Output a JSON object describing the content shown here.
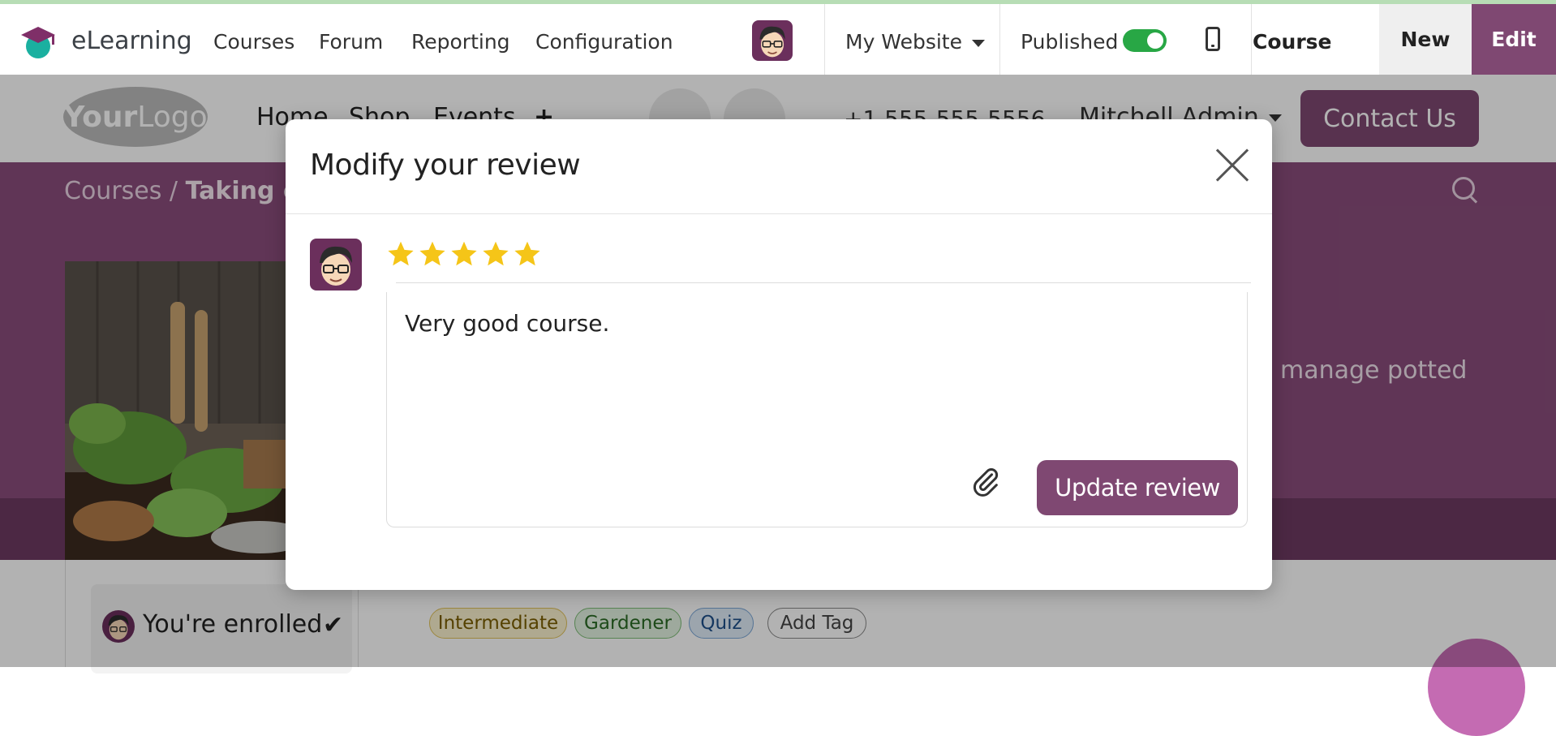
{
  "navbar": {
    "app_name": "eLearning",
    "menu": [
      "Courses",
      "Forum",
      "Reporting",
      "Configuration"
    ],
    "website_selector": "My Website",
    "published_label": "Published",
    "published": true,
    "course_label": "Course",
    "new_label": "New",
    "edit_label": "Edit"
  },
  "website": {
    "logo_bold": "Your",
    "logo_light": "Logo",
    "menu": [
      "Home",
      "Shop",
      "Events"
    ],
    "phone": "+1 555-555-5556",
    "user": "Mitchell Admin",
    "contact_label": "Contact Us",
    "breadcrumb_root": "Courses",
    "breadcrumb_sep": "/",
    "breadcrumb_current": "Taking c",
    "description_fragment": "manage potted",
    "enrolled_label": "You're enrolled",
    "tags": [
      "Intermediate",
      "Gardener",
      "Quiz",
      "Add Tag"
    ]
  },
  "modal": {
    "title": "Modify your review",
    "rating": 5,
    "rating_max": 5,
    "review_text": "Very good course.",
    "submit_label": "Update review"
  },
  "colors": {
    "brand": "#7f4872",
    "toggle_on": "#28a745",
    "star": "#f5c518"
  }
}
